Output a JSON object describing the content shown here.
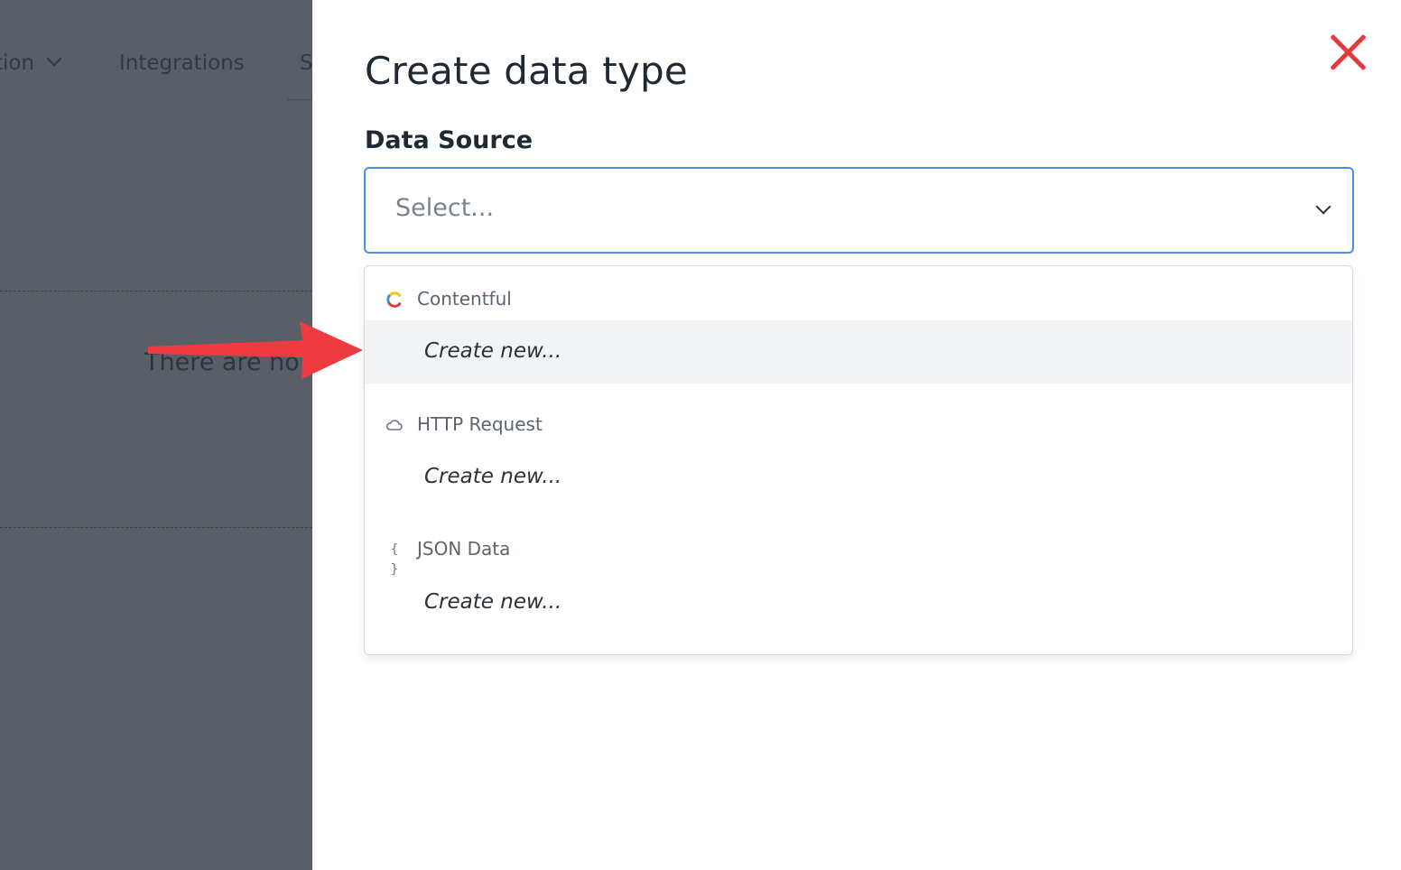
{
  "background": {
    "nav": [
      {
        "label": "tion"
      },
      {
        "label": "Integrations"
      },
      {
        "label": "S"
      }
    ],
    "empty_text": "There are no"
  },
  "panel": {
    "title": "Create data type",
    "field_label": "Data Source",
    "select": {
      "placeholder": "Select..."
    },
    "groups": [
      {
        "icon": "contentful-logo-icon",
        "label": "Contentful",
        "option": "Create new..."
      },
      {
        "icon": "cloud-icon",
        "label": "HTTP Request",
        "option": "Create new..."
      },
      {
        "icon": "braces-icon",
        "label": "JSON Data",
        "option": "Create new..."
      }
    ]
  },
  "colors": {
    "backdrop": "#595f66",
    "close": "#e23b3f",
    "focus_border": "#4a90e2",
    "annotation_arrow": "#ee3b41",
    "option_hover": "#f2f3f5"
  }
}
